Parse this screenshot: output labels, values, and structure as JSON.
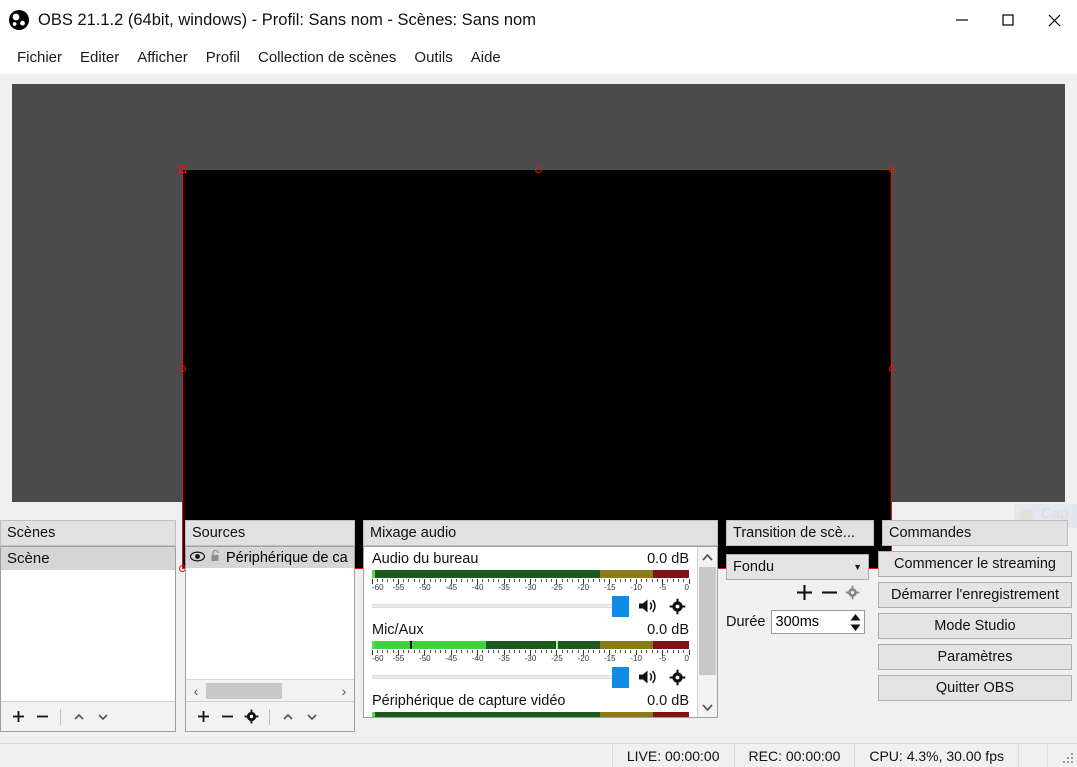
{
  "window": {
    "title": "OBS 21.1.2 (64bit, windows) - Profil: Sans nom - Scènes: Sans nom",
    "logo_icon": "obs-logo-icon",
    "minimize_icon": "minimize-icon",
    "maximize_icon": "maximize-icon",
    "close_icon": "close-icon"
  },
  "menubar": {
    "items": [
      {
        "label": "Fichier"
      },
      {
        "label": "Editer"
      },
      {
        "label": "Afficher"
      },
      {
        "label": "Profil"
      },
      {
        "label": "Collection de scènes"
      },
      {
        "label": "Outils"
      },
      {
        "label": "Aide"
      }
    ]
  },
  "preview": {
    "canvas_bg": "#4b4b4b",
    "scene_bg": "#000000",
    "selection_color": "#e8120e",
    "watermark_text": "Cap"
  },
  "scenes": {
    "title": "Scènes",
    "items": [
      {
        "label": "Scène",
        "selected": true
      }
    ],
    "toolbar": {
      "add_icon": "plus-icon",
      "remove_icon": "minus-icon",
      "move_up_icon": "chevron-up-icon",
      "move_down_icon": "chevron-down-icon"
    }
  },
  "sources": {
    "title": "Sources",
    "items": [
      {
        "label": "Périphérique de ca",
        "visible_icon": "eye-icon",
        "lock_icon": "unlock-icon"
      }
    ],
    "toolbar": {
      "add_icon": "plus-icon",
      "remove_icon": "minus-icon",
      "properties_icon": "gear-icon",
      "move_up_icon": "chevron-up-icon",
      "move_down_icon": "chevron-down-icon"
    },
    "hscroll": {
      "left_icon": "chevron-left-icon",
      "right_icon": "chevron-right-icon"
    }
  },
  "mixer": {
    "title": "Mixage audio",
    "tracks": [
      {
        "name": "Audio du bureau",
        "db": "0.0 dB",
        "level_pct": 0,
        "peak_pct": 0,
        "slider_pct": 100,
        "mute_icon": "speaker-icon",
        "settings_icon": "gear-icon"
      },
      {
        "name": "Mic/Aux",
        "db": "0.0 dB",
        "level_pct": 36,
        "peak_pct": 58,
        "magnitude_pct": 12,
        "slider_pct": 100,
        "mute_icon": "speaker-icon",
        "settings_icon": "gear-icon"
      },
      {
        "name": "Périphérique de capture vidéo",
        "db": "0.0 dB",
        "level_pct": 0,
        "peak_pct": 0,
        "slider_pct": 100,
        "mute_icon": "speaker-icon",
        "settings_icon": "gear-icon"
      }
    ],
    "scale_ticks": [
      "-60",
      "-55",
      "-50",
      "-45",
      "-40",
      "-35",
      "-30",
      "-25",
      "-20",
      "-15",
      "-10",
      "-5",
      "0"
    ],
    "zone_colors": {
      "green": "#1d5a1d",
      "yellow": "#8a7a18",
      "red": "#7e1418",
      "active": "#3fd23f"
    },
    "scroll_up_icon": "chevron-up-icon",
    "scroll_down_icon": "chevron-down-icon"
  },
  "transitions": {
    "title": "Transition de scè...",
    "selected": "Fondu",
    "dropdown_icon": "chevron-down-icon",
    "add_icon": "plus-icon",
    "remove_icon": "minus-icon",
    "settings_icon": "gear-icon",
    "duration_label": "Durée",
    "duration_value": "300ms",
    "spin_up_icon": "spin-up-icon",
    "spin_down_icon": "spin-down-icon"
  },
  "commands": {
    "title": "Commandes",
    "buttons": [
      {
        "label": "Commencer le streaming"
      },
      {
        "label": "Démarrer l'enregistrement"
      },
      {
        "label": "Mode Studio"
      },
      {
        "label": "Paramètres"
      },
      {
        "label": "Quitter OBS"
      }
    ]
  },
  "statusbar": {
    "live": "LIVE: 00:00:00",
    "rec": "REC: 00:00:00",
    "cpu": "CPU: 4.3%, 30.00 fps",
    "grip_icon": "resize-grip-icon"
  }
}
